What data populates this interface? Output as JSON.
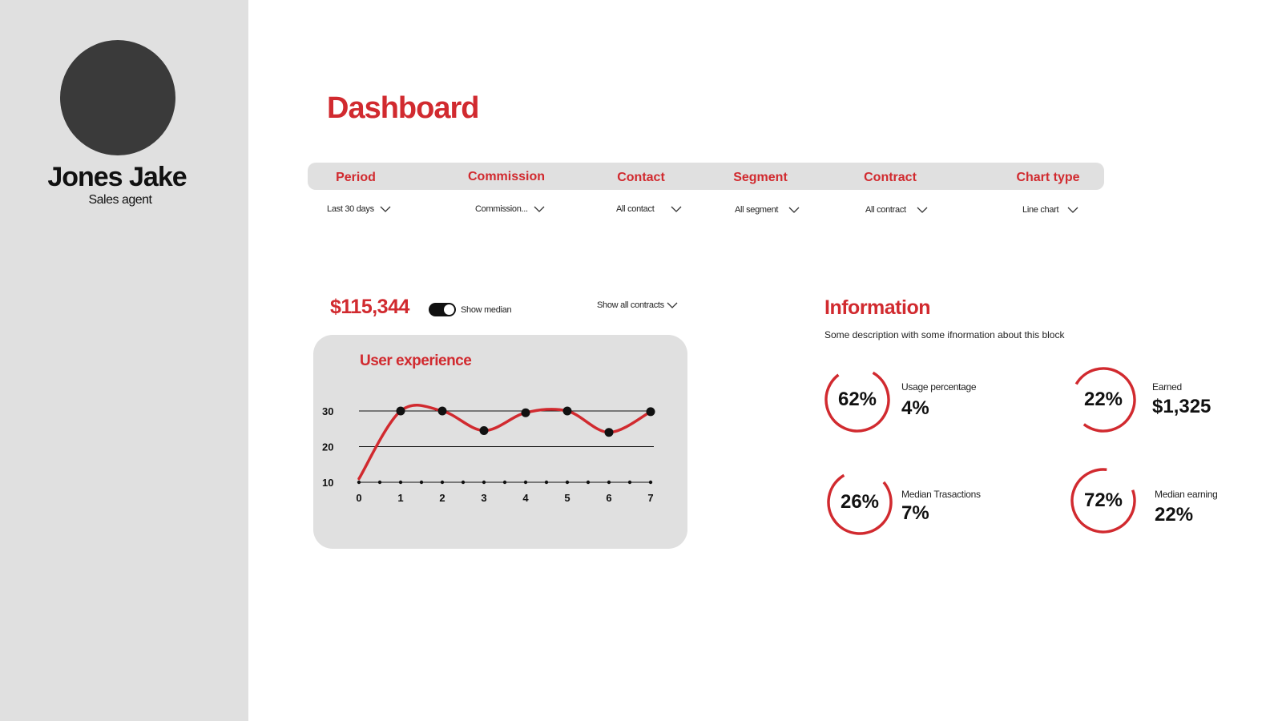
{
  "user": {
    "name": "Jones  Jake",
    "role": "Sales agent"
  },
  "page": {
    "title": "Dashboard"
  },
  "filters": [
    {
      "label": "Period",
      "value": "Last 30 days"
    },
    {
      "label": "Commission",
      "value": "Commission..."
    },
    {
      "label": "Contact",
      "value": "All contact"
    },
    {
      "label": "Segment",
      "value": "All segment"
    },
    {
      "label": "Contract",
      "value": "All contract"
    },
    {
      "label": "Chart type",
      "value": "Line chart"
    }
  ],
  "summary": {
    "amount": "$115,344",
    "show_median_label": "Show median",
    "show_median_on": true,
    "contracts_select": "Show all contracts"
  },
  "chart_data": {
    "type": "line",
    "title": "User experience",
    "x": [
      0,
      1,
      2,
      3,
      4,
      5,
      6,
      7
    ],
    "x_tick_labels": [
      "0",
      "1",
      "2",
      "3",
      "4",
      "5",
      "6",
      "7"
    ],
    "y_tick_labels": [
      "30",
      "20",
      "10"
    ],
    "y_ticks": [
      30,
      20,
      10
    ],
    "ylim": [
      10,
      30
    ],
    "markers": [
      {
        "x": 1,
        "y": 30
      },
      {
        "x": 2,
        "y": 30
      },
      {
        "x": 3,
        "y": 24.5
      },
      {
        "x": 4,
        "y": 29.5
      },
      {
        "x": 5,
        "y": 30
      },
      {
        "x": 6,
        "y": 24
      },
      {
        "x": 7,
        "y": 29.8
      }
    ],
    "series": [
      {
        "values": [
          11,
          30,
          30,
          24.5,
          29.5,
          30,
          24,
          29.8
        ]
      }
    ],
    "accent_color": "#d12a2f"
  },
  "information": {
    "title": "Information",
    "description": "Some description with some ifnormation about this block",
    "stats": [
      {
        "gauge": "62%",
        "gauge_value": 0.62,
        "label": "Usage percentage",
        "value": "4%"
      },
      {
        "gauge": "22%",
        "gauge_value": 0.22,
        "label": "Earned",
        "value": "$1,325"
      },
      {
        "gauge": "26%",
        "gauge_value": 0.26,
        "label": "Median Trasactions",
        "value": "7%"
      },
      {
        "gauge": "72%",
        "gauge_value": 0.72,
        "label": "Median earning",
        "value": "22%"
      }
    ]
  },
  "colors": {
    "accent": "#d12a2f",
    "panel": "#e0e0e0",
    "avatar": "#3a3a3a"
  }
}
